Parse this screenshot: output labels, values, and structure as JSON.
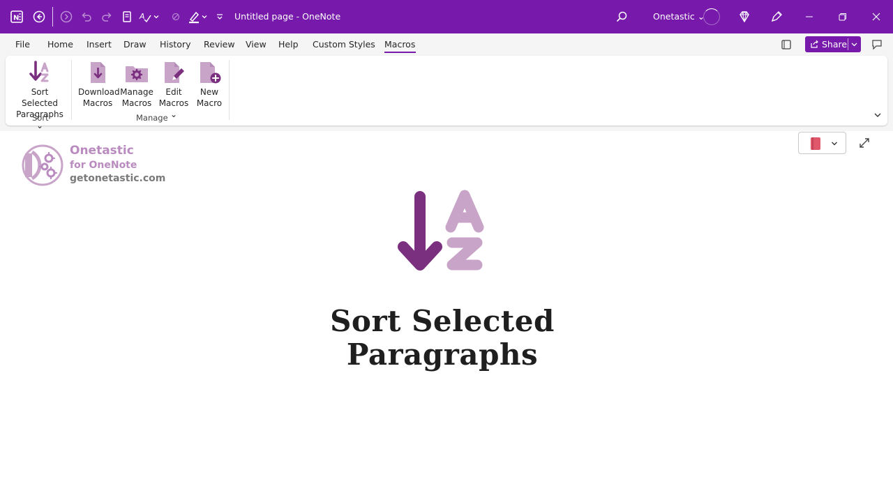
{
  "window": {
    "title": "Untitled page  -  OneNote",
    "account": "Onetastic",
    "account_chevron": "⌄"
  },
  "colors": {
    "accent": "#7719aa",
    "icon_dark": "#7a2f7f",
    "icon_light": "#c9a4c9",
    "brand_text": "#b98bbf"
  },
  "menu": {
    "tabs": [
      "File",
      "Home",
      "Insert",
      "Draw",
      "History",
      "Review",
      "View",
      "Help",
      "Custom Styles",
      "Macros"
    ],
    "active_tab": "Macros",
    "share_label": "Share"
  },
  "ribbon": {
    "sort_group": {
      "label": "Sort",
      "button_line1": "Sort Selected",
      "button_line2": "Paragraphs ⌄"
    },
    "manage_group": {
      "label": "Manage",
      "download": {
        "line1": "Download",
        "line2": "Macros"
      },
      "manage": {
        "line1": "Manage",
        "line2": "Macros"
      },
      "edit": {
        "line1": "Edit",
        "line2": "Macros ⌄"
      },
      "new": {
        "line1": "New",
        "line2": "Macro"
      }
    }
  },
  "page": {
    "brand_name": "Onetastic",
    "brand_sub": "for OneNote",
    "brand_url": "getonetastic.com",
    "title_line1": "Sort Selected",
    "title_line2": "Paragraphs"
  }
}
